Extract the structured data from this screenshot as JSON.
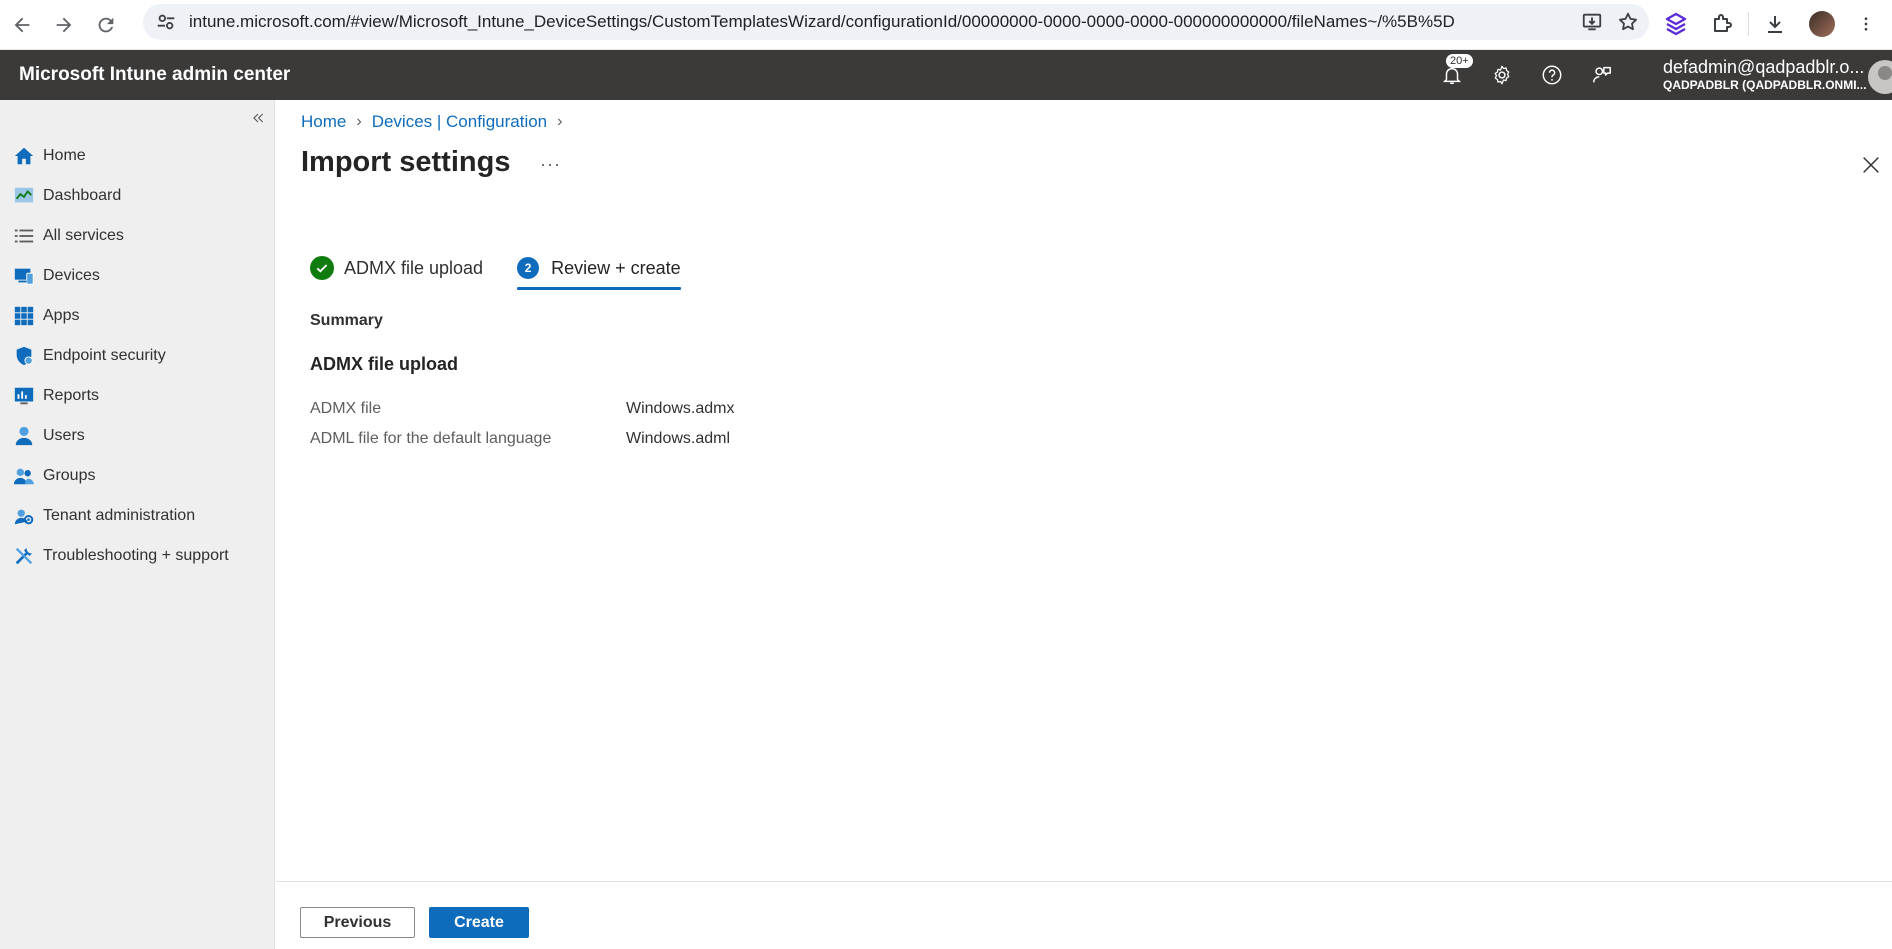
{
  "browser": {
    "url": "intune.microsoft.com/#view/Microsoft_Intune_DeviceSettings/CustomTemplatesWizard/configurationId/00000000-0000-0000-0000-000000000000/fileNames~/%5B%5D"
  },
  "header": {
    "title": "Microsoft Intune admin center",
    "notification_count": "20+",
    "user_name": "defadmin@qadpadblr.o...",
    "user_tenant": "QADPADBLR (QADPADBLR.ONMI..."
  },
  "sidebar": {
    "items": [
      {
        "label": "Home",
        "icon": "home-icon"
      },
      {
        "label": "Dashboard",
        "icon": "dashboard-icon"
      },
      {
        "label": "All services",
        "icon": "all-services-icon"
      },
      {
        "label": "Devices",
        "icon": "devices-icon"
      },
      {
        "label": "Apps",
        "icon": "apps-icon"
      },
      {
        "label": "Endpoint security",
        "icon": "shield-icon"
      },
      {
        "label": "Reports",
        "icon": "reports-icon"
      },
      {
        "label": "Users",
        "icon": "user-icon"
      },
      {
        "label": "Groups",
        "icon": "groups-icon"
      },
      {
        "label": "Tenant administration",
        "icon": "tenant-admin-icon"
      },
      {
        "label": "Troubleshooting + support",
        "icon": "troubleshooting-icon"
      }
    ]
  },
  "breadcrumb": [
    "Home",
    "Devices | Configuration"
  ],
  "page": {
    "title": "Import settings",
    "more": "···"
  },
  "steps": [
    {
      "label": "ADMX file upload",
      "status": "complete"
    },
    {
      "number": "2",
      "label": "Review + create",
      "status": "active"
    }
  ],
  "summary": {
    "label": "Summary",
    "section_title": "ADMX file upload",
    "fields": [
      {
        "label": "ADMX file",
        "value": "Windows.admx"
      },
      {
        "label": "ADML file for the default language",
        "value": "Windows.adml"
      }
    ]
  },
  "footer": {
    "previous_label": "Previous",
    "create_label": "Create"
  },
  "colors": {
    "accent": "#0f6cbd",
    "success": "#107c10",
    "header_bg": "#3b3a39",
    "sidebar_bg": "#efefef"
  }
}
